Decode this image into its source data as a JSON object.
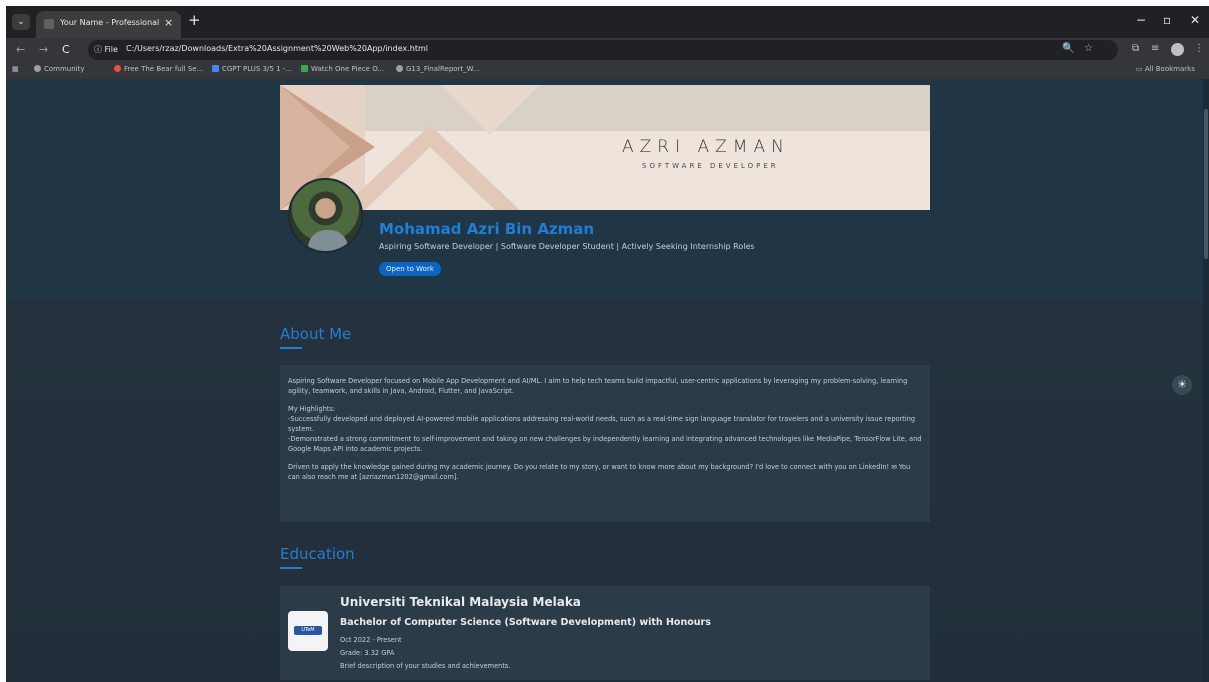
{
  "browser": {
    "tab_title": "Your Name - Professional Portf...",
    "tab_close": "×",
    "new_tab": "+",
    "window_controls": {
      "minimize": "−",
      "maximize": "▫",
      "close": "✕"
    },
    "nav": {
      "back": "←",
      "forward": "→",
      "reload": "C"
    },
    "file_chip": "ⓘ File",
    "url": "C:/Users/rzaz/Downloads/Extra%20Assignment%20Web%20App/index.html",
    "omnibox_icons": {
      "zoom": "🔍",
      "star": "☆"
    },
    "bookmarks": [
      {
        "label": "Community",
        "color": "#9aa0a6"
      },
      {
        "label": "Free The Bear full Se...",
        "color": "#e8543b"
      },
      {
        "label": "CGPT PLUS 3/5 1 -...",
        "color": "#4285f4"
      },
      {
        "label": "Watch One Piece O...",
        "color": "#34a853"
      },
      {
        "label": "G13_FinalReport_W...",
        "color": "#9aa0a6"
      }
    ],
    "all_bookmarks": "All Bookmarks"
  },
  "profile": {
    "banner_name": "AZRI AZMAN",
    "banner_role": "SOFTWARE DEVELOPER",
    "name": "Mohamad Azri Bin Azman",
    "headline": "Aspiring Software Developer | Software Developer Student | Actively Seeking Internship Roles",
    "open_to_work": "Open to Work"
  },
  "about": {
    "title": "About Me",
    "p1": "Aspiring Software Developer focused on Mobile App Development and AI/ML. I aim to help tech teams build impactful, user-centric applications by leveraging my problem-solving, learning agility, teamwork, and skills in Java, Android, Flutter, and JavaScript.",
    "highlights_title": "My Highlights:",
    "h1": "-Successfully developed and deployed AI-powered mobile applications addressing real-world needs, such as a real-time sign language translator for travelers and a university issue reporting system.",
    "h2": "-Demonstrated a strong commitment to self-improvement and taking on new challenges by independently learning and integrating advanced technologies like MediaPipe, TensorFlow Lite, and Google Maps API into academic projects.",
    "p3": "Driven to apply the knowledge gained during my academic journey. Do you relate to my story, or want to know more about my background? I'd love to connect with you on LinkedIn! ✉ You can also reach me at [azriazman1202@gmail.com]."
  },
  "education": {
    "title": "Education",
    "school": "Universiti Teknikal Malaysia Melaka",
    "degree": "Bachelor of Computer Science (Software Development) with Honours",
    "dates": "Oct 2022 - Present",
    "grade": "Grade: 3.32 GPA",
    "description": "Brief description of your studies and achievements.",
    "logo_text": "UTeM"
  },
  "theme_toggle_icon": "☀",
  "colors": {
    "accent": "#1f7ed6",
    "button": "#0a66c2",
    "page_bg": "#22313d",
    "card_bg": "#2c3b48"
  }
}
